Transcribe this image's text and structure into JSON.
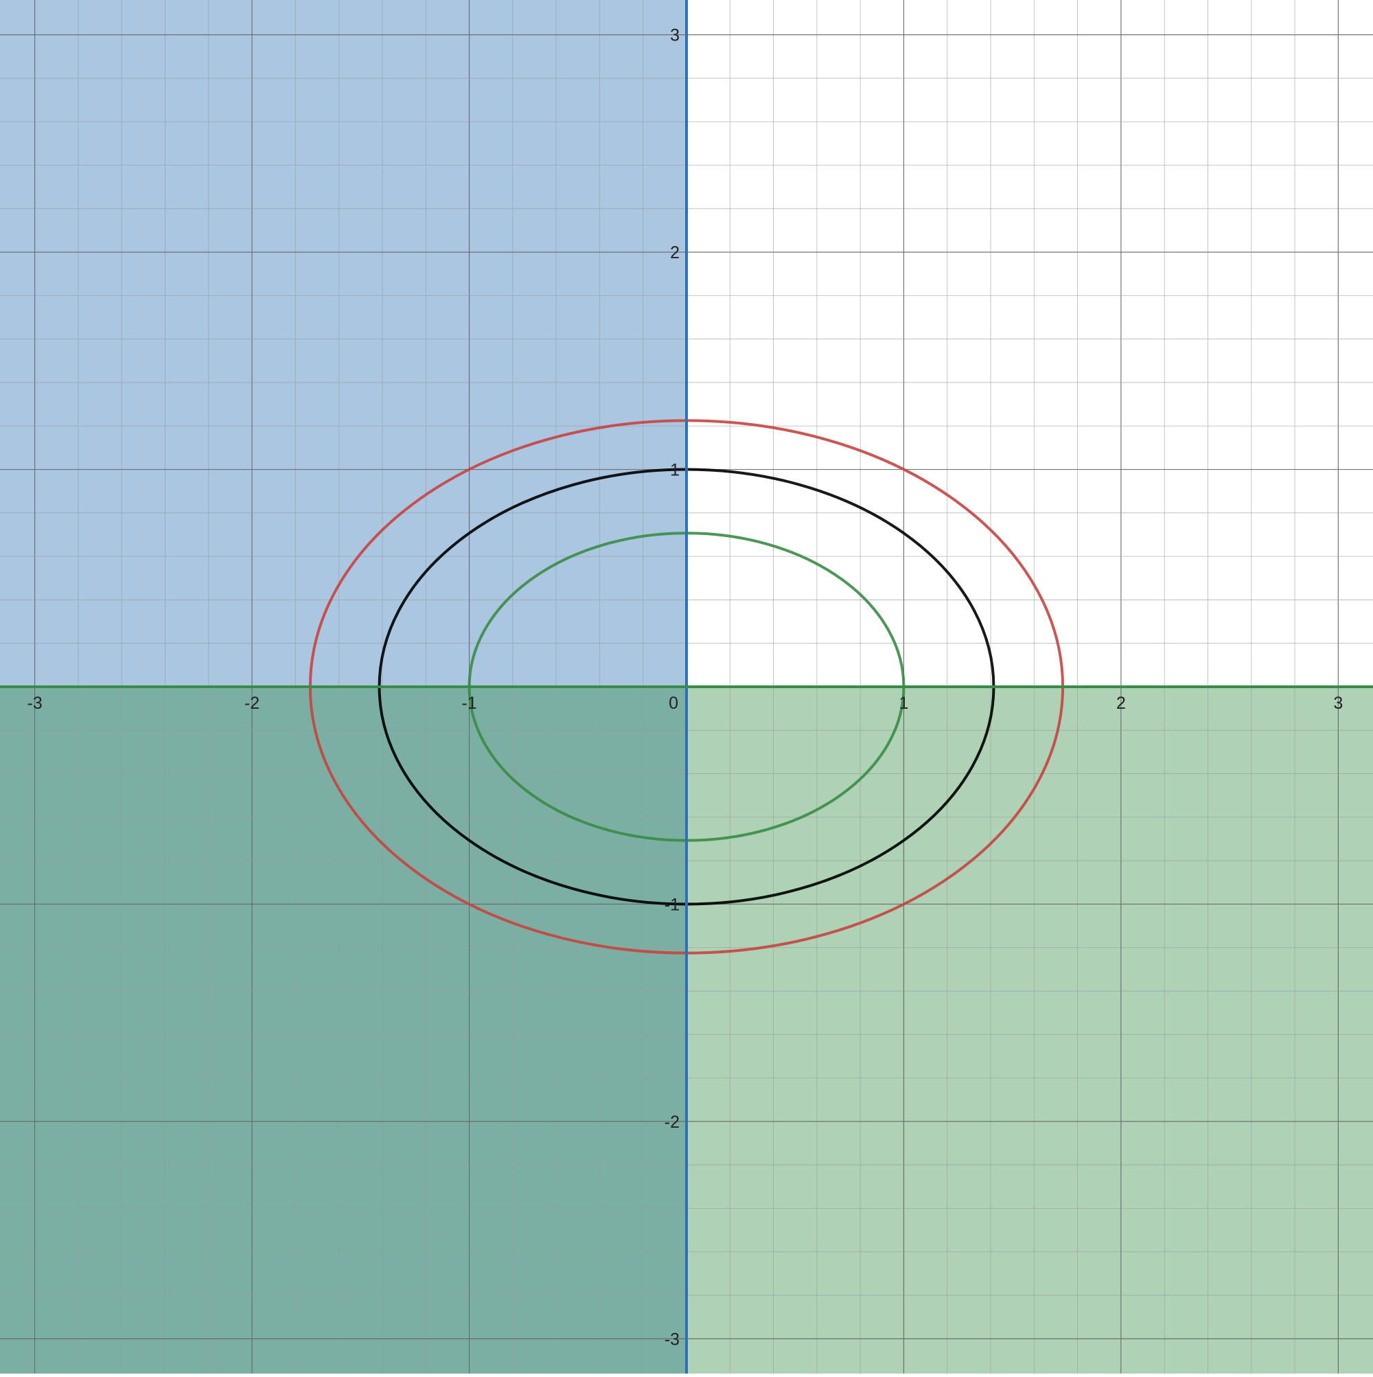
{
  "chart_data": {
    "type": "scatter",
    "title": "",
    "xlabel": "",
    "ylabel": "",
    "xlim": [
      -3.16,
      3.16
    ],
    "ylim": [
      -3.16,
      3.16
    ],
    "grid": true,
    "minor_grid_step": 0.2,
    "major_grid_step": 1,
    "x_tick_labels": [
      "-3",
      "-2",
      "-1",
      "0",
      "1",
      "2",
      "3"
    ],
    "x_tick_values": [
      -3,
      -2,
      -1,
      0,
      1,
      2,
      3
    ],
    "y_tick_labels": [
      "3",
      "2",
      "1",
      "-1",
      "-2",
      "-3"
    ],
    "y_tick_values": [
      3,
      2,
      1,
      -1,
      -2,
      -3
    ],
    "shaded_regions": [
      {
        "inequality": "x < 0",
        "color": "#2d70b3",
        "opacity": 0.4
      },
      {
        "inequality": "y < 0",
        "color": "#388c46",
        "opacity": 0.4
      }
    ],
    "boundary_lines": [
      {
        "orientation": "vertical",
        "value": 0,
        "color": "#2d70b3"
      },
      {
        "orientation": "horizontal",
        "value": 0,
        "color": "#388c46"
      }
    ],
    "ellipses": [
      {
        "center": [
          0,
          0
        ],
        "semi_x": 1.732,
        "semi_y": 1.225,
        "color": "#c74440"
      },
      {
        "center": [
          0,
          0
        ],
        "semi_x": 1.414,
        "semi_y": 1.0,
        "color": "#000000"
      },
      {
        "center": [
          0,
          0
        ],
        "semi_x": 1.0,
        "semi_y": 0.707,
        "color": "#388c46"
      }
    ]
  }
}
